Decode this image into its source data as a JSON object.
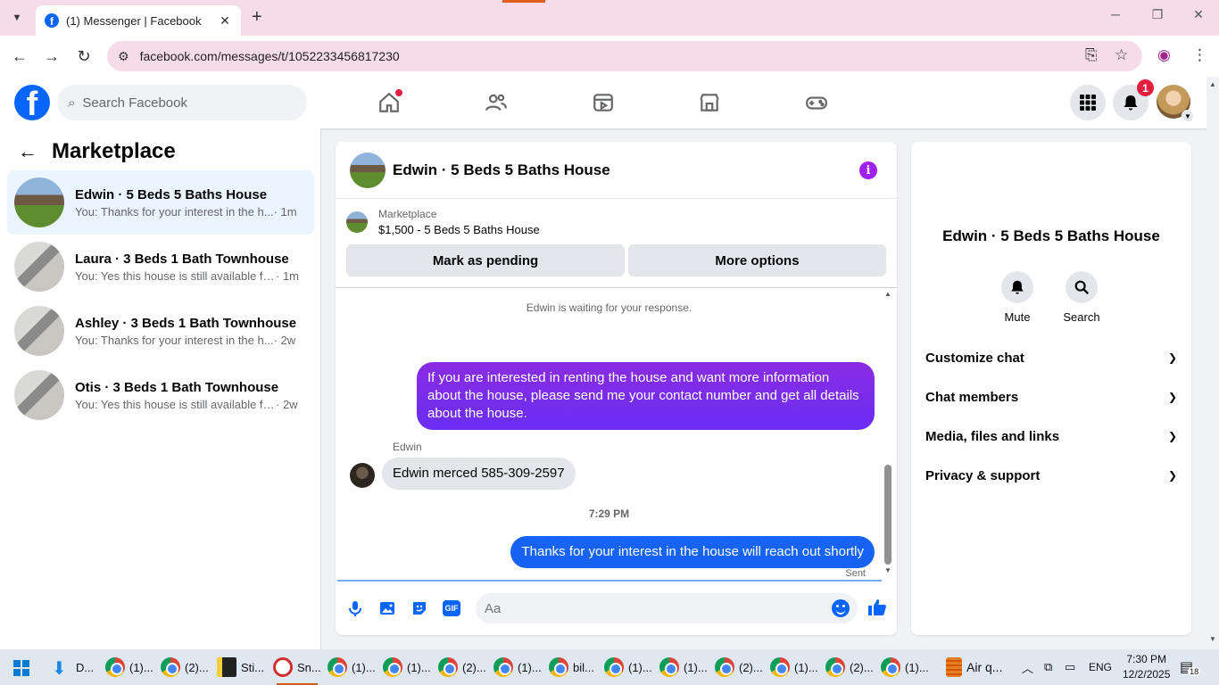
{
  "browser": {
    "tab_title": "(1) Messenger | Facebook",
    "tab_favicon_letter": "f",
    "url": "facebook.com/messages/t/1052233456817230"
  },
  "fb": {
    "logo_letter": "f",
    "search_placeholder": "Search Facebook",
    "notification_count": "1"
  },
  "left": {
    "title": "Marketplace",
    "conversations": [
      {
        "name": "Edwin · 5 Beds 5 Baths House",
        "snippet": "You: Thanks for your interest in the h...",
        "time": "· 1m"
      },
      {
        "name": "Laura · 3 Beds 1 Bath Townhouse",
        "snippet": "You: Yes this house is still available fo...",
        "time": "· 1m"
      },
      {
        "name": "Ashley · 3 Beds 1 Bath Townhouse",
        "snippet": "You: Thanks for your interest in the h...",
        "time": "· 2w"
      },
      {
        "name": "Otis · 3 Beds 1 Bath Townhouse",
        "snippet": "You: Yes this house is still available for...",
        "time": "· 2w"
      }
    ]
  },
  "chat": {
    "title": "Edwin · 5 Beds 5 Baths House",
    "listing_label": "Marketplace",
    "listing_price": "$1,500 - 5 Beds 5 Baths House",
    "mark_pending": "Mark as pending",
    "more_options": "More options",
    "waiting": "Edwin is waiting for your response.",
    "msg_out_1": "If you are interested in renting the house and want more information about the house, please send me your contact number and get all details about the house.",
    "sender": "Edwin",
    "msg_in_1": "Edwin merced 585-309-2597",
    "timestamp": "7:29 PM",
    "msg_out_2": "Thanks for your interest in the house will reach out shortly",
    "sent": "Sent",
    "input_placeholder": "Aa",
    "gif": "GIF"
  },
  "right": {
    "title": "Edwin · 5 Beds 5 Baths House",
    "mute": "Mute",
    "search": "Search",
    "items": [
      "Customize chat",
      "Chat members",
      "Media, files and links",
      "Privacy & support"
    ]
  },
  "taskbar": {
    "items": [
      "D...",
      "(1)...",
      "(2)...",
      "Sti...",
      "Sn...",
      "(1)...",
      "(1)...",
      "(2)...",
      "(1)...",
      "bil...",
      "(1)...",
      "(1)...",
      "(2)...",
      "(1)...",
      "(2)...",
      "(1)..."
    ],
    "weather": "Air q...",
    "lang": "ENG",
    "time": "7:30 PM",
    "date": "12/2/2025",
    "notif_count": "18"
  }
}
